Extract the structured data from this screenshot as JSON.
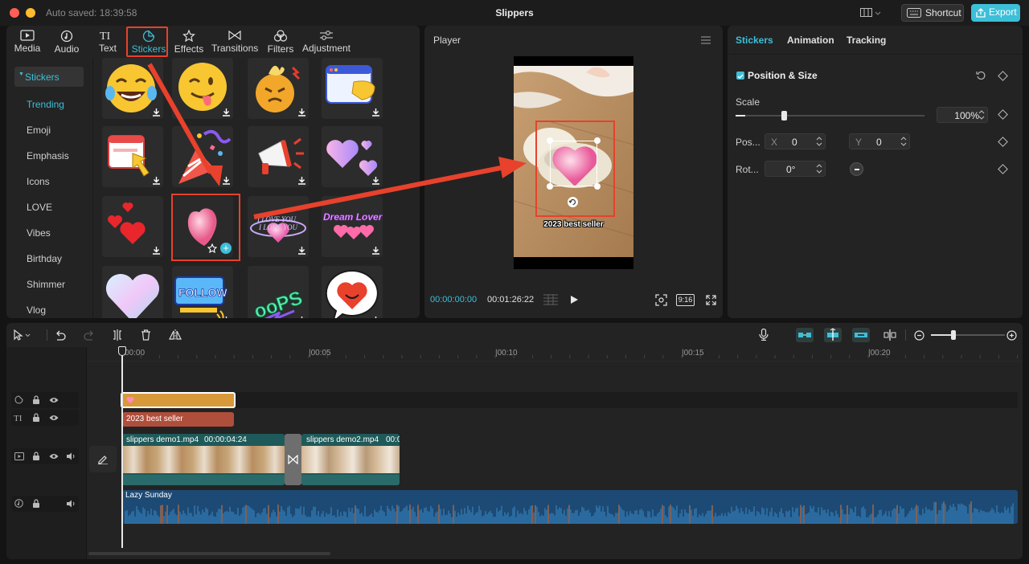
{
  "window": {
    "title": "Slippers",
    "autosave": "Auto saved: 18:39:58",
    "shortcut_label": "Shortcut",
    "export_label": "Export"
  },
  "toolbar": {
    "items": [
      {
        "label": "Media",
        "icon": "media-icon"
      },
      {
        "label": "Audio",
        "icon": "audio-icon"
      },
      {
        "label": "Text",
        "icon": "text-icon"
      },
      {
        "label": "Stickers",
        "icon": "stickers-icon",
        "active": true
      },
      {
        "label": "Effects",
        "icon": "effects-icon"
      },
      {
        "label": "Transitions",
        "icon": "transitions-icon"
      },
      {
        "label": "Filters",
        "icon": "filters-icon"
      },
      {
        "label": "Adjustment",
        "icon": "adjustment-icon"
      }
    ]
  },
  "sidebar": {
    "header": "Stickers",
    "items": [
      "Trending",
      "Emoji",
      "Emphasis",
      "Icons",
      "LOVE",
      "Vibes",
      "Birthday",
      "Shimmer",
      "Vlog"
    ],
    "active_index": 0
  },
  "sticker_texts": {
    "follow": "FOLLOW",
    "love_you": "I LOVE YOU",
    "dream_lover": "Dream Lover",
    "oops": "ooPS"
  },
  "player": {
    "title": "Player",
    "current_time": "00:00:00:00",
    "total_time": "00:01:26:22",
    "ratio": "9:16",
    "caption": "2023 best seller"
  },
  "inspector": {
    "tabs": [
      "Stickers",
      "Animation",
      "Tracking"
    ],
    "active_tab": 0,
    "section": "Position & Size",
    "scale_label": "Scale",
    "scale_value": "100%",
    "scale_fraction": 0.05,
    "pos_label": "Pos...",
    "x_label": "X",
    "x_value": "0",
    "y_label": "Y",
    "y_value": "0",
    "rot_label": "Rot...",
    "rot_value": "0°"
  },
  "timeline": {
    "ticks": [
      "00:00",
      "|00:05",
      "|00:10",
      "|00:15",
      "|00:20"
    ],
    "text_clip": "2023 best seller",
    "video_clips": [
      {
        "name": "slippers demo1.mp4",
        "duration": "00:00:04:24"
      },
      {
        "name": "slippers demo2.mp4",
        "duration": "00:0"
      }
    ],
    "audio_clip": "Lazy Sunday",
    "zoom_fraction": 0.27
  },
  "colors": {
    "accent": "#3dbfd8",
    "annotation": "#e8412c",
    "sticker_clip": "#d8993a",
    "text_clip": "#b04e3c",
    "video_clip": "#1f5a5a",
    "audio_clip": "#1c4a74"
  }
}
